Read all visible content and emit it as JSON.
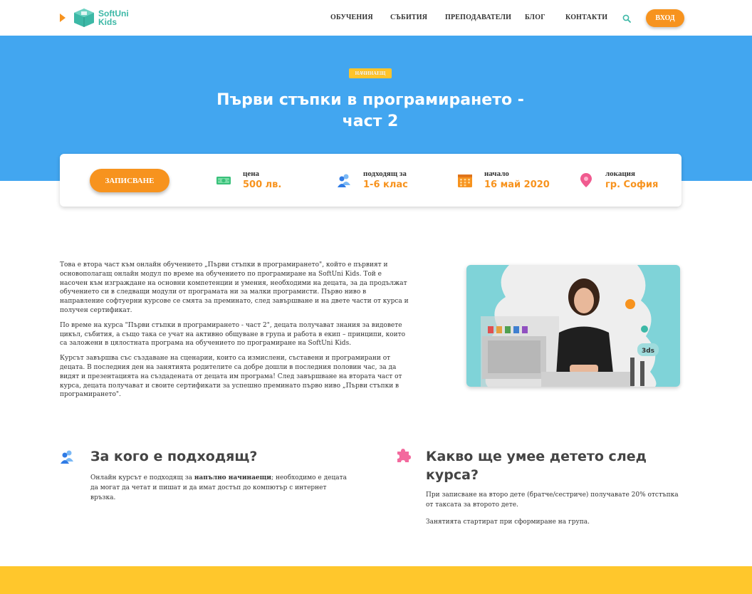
{
  "brand": {
    "logo_line1": "SoftUni",
    "logo_line2": "Kids"
  },
  "nav": {
    "items": [
      "ОБУЧЕНИЯ",
      "СЪБИТИЯ",
      "ПРЕПОДАВАТЕЛИ",
      "БЛОГ",
      "КОНТАКТИ"
    ],
    "login_label": "ВХОД"
  },
  "hero": {
    "level_badge": "НАЧИНАЕЩ",
    "title": "Първи стъпки в програмирането - част 2"
  },
  "info": {
    "enroll_label": "ЗАПИСВАНЕ",
    "items": [
      {
        "label": "цена",
        "value": "500 лв.",
        "icon": "money-icon"
      },
      {
        "label": "подходящ за",
        "value": "1-6 клас",
        "icon": "users-icon"
      },
      {
        "label": "начало",
        "value": "16 май 2020",
        "icon": "calendar-icon"
      },
      {
        "label": "локация",
        "value": "гр. София",
        "icon": "location-pin-icon"
      }
    ]
  },
  "description": {
    "paragraphs": [
      "Това е втора част към онлайн обучението „Първи стъпки в програмирането\", който е първият и основополагащ онлайн модул по време на обучението по програмиране на SoftUni Kids. Той е насочен към изграждане на основни компетенции и умения, необходими на децата, за да продължат обучението си в следващи модули от програмата ни за малки програмисти. Първо ниво в направление софтуерни курсове се смята за преминато, след завършване и на двете части от курса и получен сертификат.",
      "По време на курса \"Първи стъпки в програмирането - част 2\", децата получават знания за видовете цикъл, събития, а също така се учат на активно общуване в група и работа в екип – принципи, които са заложени в цялостната програма на обучението по програмиране на SoftUni Kids.",
      "Курсът завършва със създаване на сценарии, които са измислени, съставени и програмирани от децата. В последния ден на занятията родителите са добре дошли в последния половин час, за да видят и презентацията на създадената от децата им програма! След завършване на втората част от курса, децата получават и своите сертификати за успешно преминато първо ниво „Първи стъпки в програмирането\"."
    ]
  },
  "video": {
    "caption": "3ds"
  },
  "who": {
    "title": "За кого е подходящ?",
    "text_before": "Онлайн курсът е подходящ за ",
    "text_bold": "напълно начинаещи",
    "text_after": "; необходимо е децата да могат да четат и пишат и да имат достъп до компютър с интернет връзка."
  },
  "skills": {
    "title": "Какво ще умее детето след курса?",
    "paragraphs": [
      "При записване на второ дете (братче/сестриче) получавате 20% отстъпка от таксата за второто дете.",
      "Занятията стартират при сформиране на група."
    ]
  },
  "colors": {
    "primary_blue": "#42a6f0",
    "accent_orange": "#f7931e",
    "badge_yellow": "#ffc42a",
    "footer_yellow": "#ffc72c",
    "teal": "#3cb8a6"
  }
}
